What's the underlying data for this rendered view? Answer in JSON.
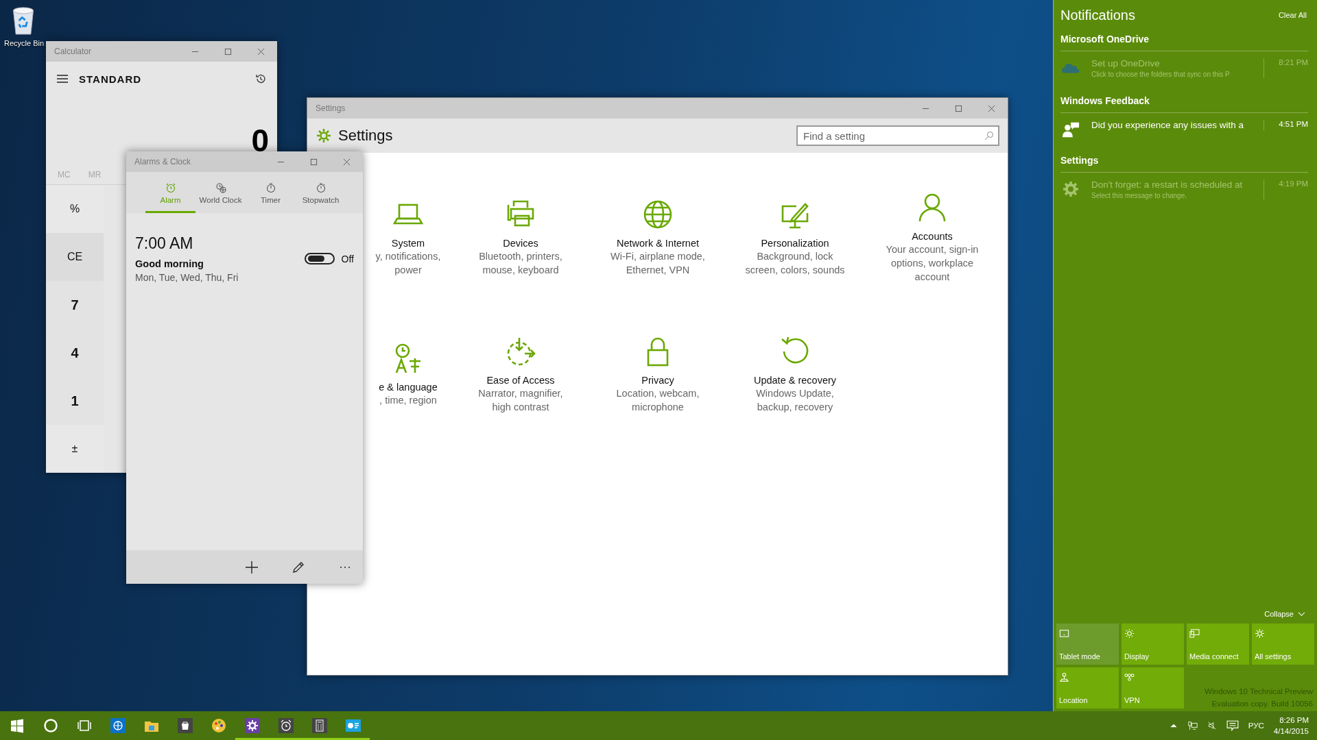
{
  "desktop": {
    "icon_label": "Recycle Bin",
    "watermark": [
      "Windows 10 Technical Preview",
      "Evaluation copy. Build 10056"
    ]
  },
  "calculator": {
    "title": "Calculator",
    "mode": "STANDARD",
    "display": "0",
    "memory": [
      "MC",
      "MR"
    ],
    "keys": [
      "%",
      "CE",
      "7",
      "4",
      "1",
      "±"
    ]
  },
  "alarms_clock": {
    "title": "Alarms & Clock",
    "tabs": [
      {
        "label": "Alarm",
        "selected": true
      },
      {
        "label": "World Clock",
        "selected": false
      },
      {
        "label": "Timer",
        "selected": false
      },
      {
        "label": "Stopwatch",
        "selected": false
      }
    ],
    "alarms": [
      {
        "time": "7:00 AM",
        "name": "Good morning",
        "days": "Mon, Tue, Wed, Thu, Fri",
        "on": false,
        "state_label": "Off"
      }
    ]
  },
  "settings": {
    "title": "Settings",
    "heading": "Settings",
    "search": {
      "placeholder": "Find a setting"
    },
    "tiles": [
      {
        "label": "System",
        "description": "y, notifications,\npower"
      },
      {
        "label": "Devices",
        "description": "Bluetooth, printers,\nmouse, keyboard"
      },
      {
        "label": "Network & Internet",
        "description": "Wi-Fi, airplane mode,\nEthernet, VPN"
      },
      {
        "label": "Personalization",
        "description": "Background, lock\nscreen, colors, sounds"
      },
      {
        "label": "Accounts",
        "description": "Your account, sign-in\noptions, workplace\naccount"
      },
      {
        "label": "e & language",
        "description": ", time, region"
      },
      {
        "label": "Ease of Access",
        "description": "Narrator, magnifier,\nhigh contrast"
      },
      {
        "label": "Privacy",
        "description": "Location, webcam,\nmicrophone"
      },
      {
        "label": "Update & recovery",
        "description": "Windows Update,\nbackup, recovery"
      }
    ]
  },
  "notifications": {
    "title": "Notifications",
    "clear": "Clear All",
    "groups": [
      {
        "app": "Microsoft OneDrive",
        "items": [
          {
            "title": "Set up OneDrive",
            "body": "Click to choose the folders that sync on this P",
            "time": "8:21 PM",
            "read": true
          }
        ]
      },
      {
        "app": "Windows Feedback",
        "items": [
          {
            "title": "Did you experience any issues with a",
            "time": "4:51 PM",
            "read": false
          }
        ]
      },
      {
        "app": "Settings",
        "items": [
          {
            "title": "Don't forget: a restart is scheduled at",
            "body": "Select this message to change.",
            "time": "4:19 PM",
            "read": true
          }
        ]
      }
    ],
    "collapse": "Collapse",
    "quick_actions": [
      {
        "label": "Tablet mode",
        "on": false
      },
      {
        "label": "Display",
        "on": true
      },
      {
        "label": "Media connect",
        "on": true
      },
      {
        "label": "All settings",
        "on": true
      },
      {
        "label": "Location",
        "on": true
      },
      {
        "label": "VPN",
        "on": true
      }
    ]
  },
  "taskbar": {
    "buttons": [
      {
        "running": false
      },
      {
        "running": false
      },
      {
        "running": false
      },
      {
        "running": false
      },
      {
        "running": false
      },
      {
        "running": false
      },
      {
        "running": false
      },
      {
        "running": true
      },
      {
        "running": true
      },
      {
        "running": true
      },
      {
        "running": true
      }
    ],
    "language": "РУС",
    "time": "8:26 PM",
    "date": "4/14/2015"
  }
}
